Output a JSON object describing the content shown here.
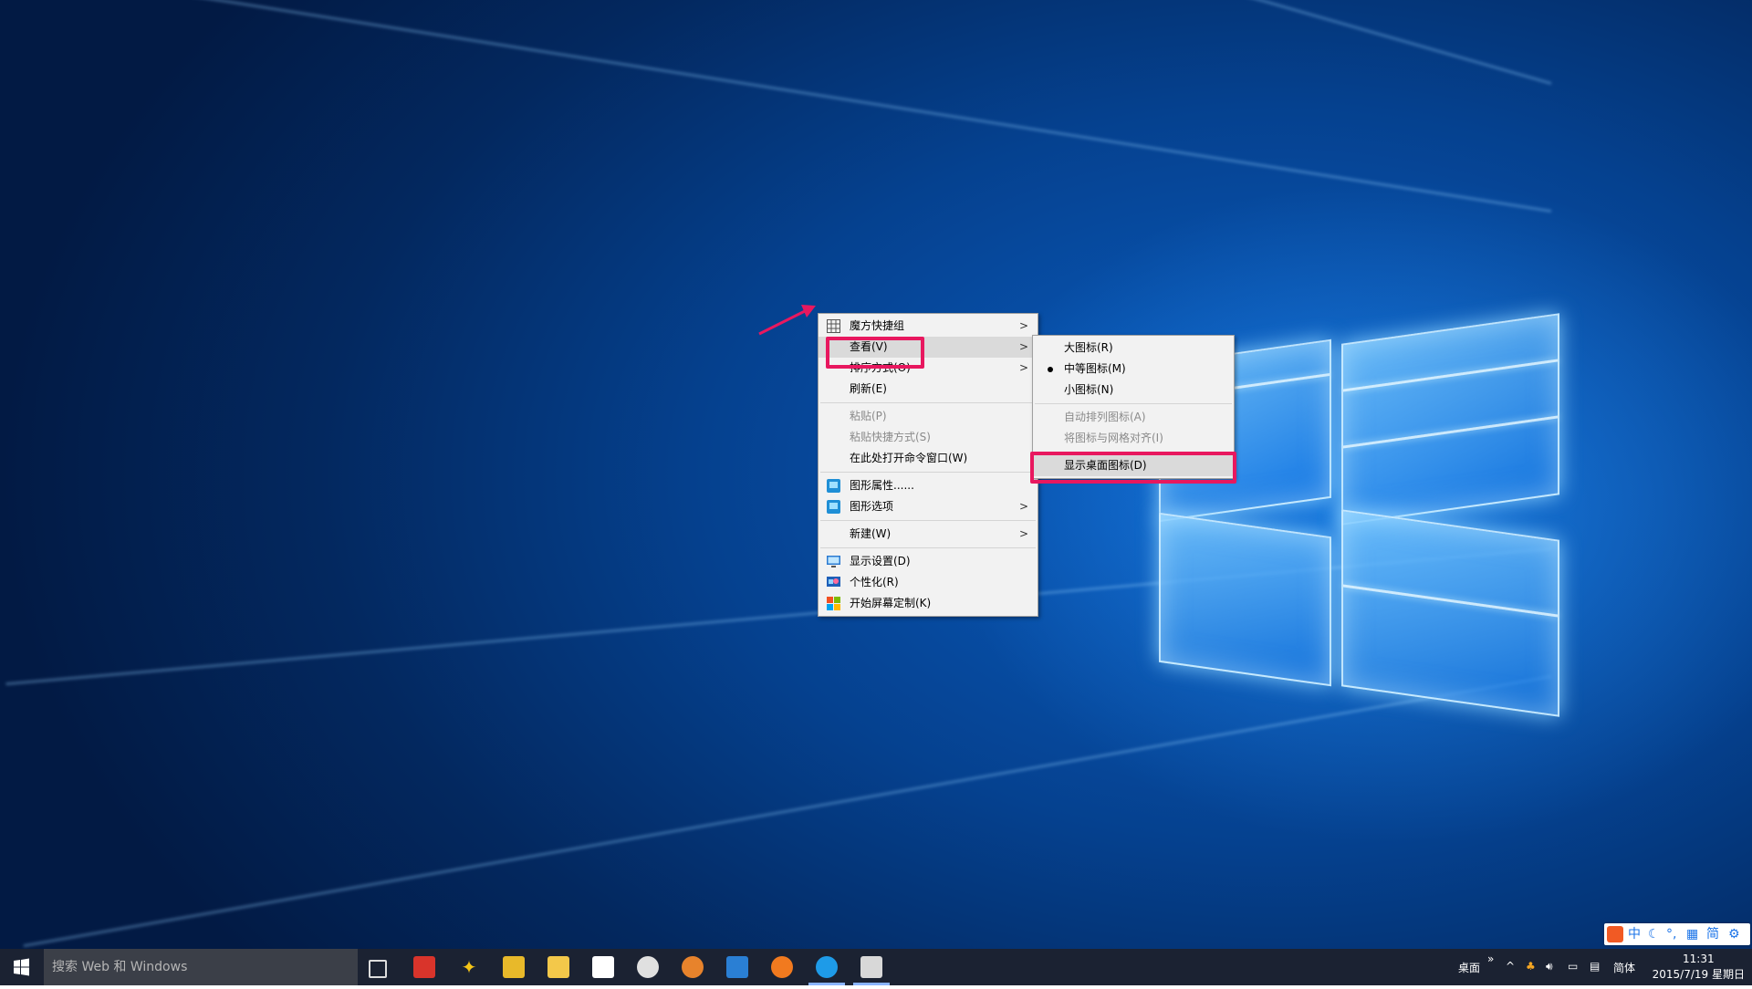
{
  "context_menu": {
    "items": [
      {
        "label": "魔方快捷组",
        "icon": "grid-icon",
        "has_submenu": true
      },
      {
        "label": "查看(V)",
        "has_submenu": true,
        "hover": true
      },
      {
        "label": "排序方式(O)",
        "has_submenu": true
      },
      {
        "label": "刷新(E)"
      },
      {
        "label": "粘贴(P)",
        "disabled": true
      },
      {
        "label": "粘贴快捷方式(S)",
        "disabled": true
      },
      {
        "label": "在此处打开命令窗口(W)"
      },
      {
        "label": "图形属性......",
        "icon": "graphics-properties-icon"
      },
      {
        "label": "图形选项",
        "icon": "graphics-options-icon",
        "has_submenu": true
      },
      {
        "label": "新建(W)",
        "has_submenu": true
      },
      {
        "label": "显示设置(D)",
        "icon": "display-settings-icon"
      },
      {
        "label": "个性化(R)",
        "icon": "personalize-icon"
      },
      {
        "label": "开始屏幕定制(K)",
        "icon": "start-screen-icon"
      }
    ]
  },
  "view_submenu": {
    "items": [
      {
        "label": "大图标(R)"
      },
      {
        "label": "中等图标(M)",
        "selected": true
      },
      {
        "label": "小图标(N)"
      },
      {
        "label": "自动排列图标(A)",
        "disabled": true
      },
      {
        "label": "将图标与网格对齐(I)",
        "disabled": true
      },
      {
        "label": "显示桌面图标(D)",
        "hover": true
      }
    ]
  },
  "taskbar": {
    "search_placeholder": "搜索 Web 和 Windows",
    "pinned_icons": [
      "task-view-icon",
      "power-app-icon",
      "magic-wand-icon",
      "package-icon",
      "file-explorer-icon",
      "store-icon",
      "media-player-icon",
      "pear-app-icon",
      "windows-app-icon",
      "firefox-icon",
      "browser-icon",
      "notepad-icon"
    ],
    "tray": {
      "desktop_label": "桌面",
      "expand_label": "»",
      "ime_lang": "简体",
      "time": "11:31",
      "date": "2015/7/19 星期日"
    }
  },
  "ime_bar": {
    "items": [
      "中",
      "简"
    ]
  },
  "colors": {
    "highlight": "#e8185f",
    "taskbar": "#1b2232"
  }
}
